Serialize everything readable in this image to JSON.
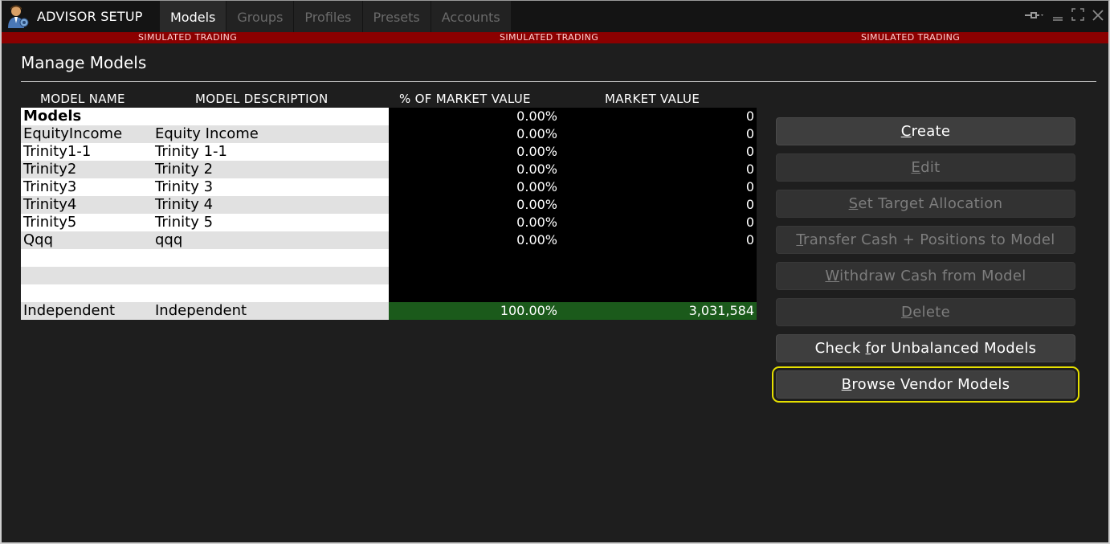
{
  "app": {
    "title": "ADVISOR SETUP",
    "tabs": [
      {
        "label": "Models",
        "active": true
      },
      {
        "label": "Groups",
        "active": false
      },
      {
        "label": "Profiles",
        "active": false
      },
      {
        "label": "Presets",
        "active": false
      },
      {
        "label": "Accounts",
        "active": false
      }
    ],
    "controls": {
      "pin": "pin-icon",
      "minimize": "minimize-icon",
      "maximize": "maximize-icon",
      "close": "close-icon"
    }
  },
  "banner": {
    "texts": [
      "SIMULATED TRADING",
      "SIMULATED TRADING",
      "SIMULATED TRADING"
    ],
    "color": "#8b0000"
  },
  "panel": {
    "title": "Manage Models"
  },
  "table": {
    "columns": [
      "MODEL NAME",
      "MODEL DESCRIPTION",
      "% OF MARKET VALUE",
      "MARKET VALUE"
    ],
    "rows": [
      {
        "name": "Models",
        "description": "",
        "pct": "0.00%",
        "market_value": "0"
      },
      {
        "name": "EquityIncome",
        "description": "Equity Income",
        "pct": "0.00%",
        "market_value": "0"
      },
      {
        "name": "Trinity1-1",
        "description": "Trinity 1-1",
        "pct": "0.00%",
        "market_value": "0"
      },
      {
        "name": "Trinity2",
        "description": "Trinity 2",
        "pct": "0.00%",
        "market_value": "0"
      },
      {
        "name": "Trinity3",
        "description": "Trinity 3",
        "pct": "0.00%",
        "market_value": "0"
      },
      {
        "name": "Trinity4",
        "description": "Trinity 4",
        "pct": "0.00%",
        "market_value": "0"
      },
      {
        "name": "Trinity5",
        "description": "Trinity 5",
        "pct": "0.00%",
        "market_value": "0"
      },
      {
        "name": "Qqq",
        "description": "qqq",
        "pct": "0.00%",
        "market_value": "0"
      },
      {
        "name": "",
        "description": "",
        "pct": "",
        "market_value": ""
      },
      {
        "name": "",
        "description": "",
        "pct": "",
        "market_value": ""
      },
      {
        "name": "",
        "description": "",
        "pct": "",
        "market_value": ""
      },
      {
        "name": "Independent",
        "description": "Independent",
        "pct": "100.00%",
        "market_value": "3,031,584"
      }
    ],
    "total_row_color": "#1b5a1b"
  },
  "buttons": [
    {
      "pre": "",
      "key": "C",
      "post": "reate",
      "enabled": true,
      "focused": false
    },
    {
      "pre": "",
      "key": "E",
      "post": "dit",
      "enabled": false,
      "focused": false
    },
    {
      "pre": "",
      "key": "S",
      "post": "et Target Allocation",
      "enabled": false,
      "focused": false
    },
    {
      "pre": "",
      "key": "T",
      "post": "ransfer Cash + Positions to Model",
      "enabled": false,
      "focused": false
    },
    {
      "pre": "",
      "key": "W",
      "post": "ithdraw Cash from Model",
      "enabled": false,
      "focused": false
    },
    {
      "pre": "",
      "key": "D",
      "post": "elete",
      "enabled": false,
      "focused": false
    },
    {
      "pre": "Check ",
      "key": "f",
      "post": "or Unbalanced Models",
      "enabled": true,
      "focused": false
    },
    {
      "pre": "",
      "key": "B",
      "post": "rowse Vendor Models",
      "enabled": true,
      "focused": true
    }
  ],
  "focus_color": "#e6e000"
}
